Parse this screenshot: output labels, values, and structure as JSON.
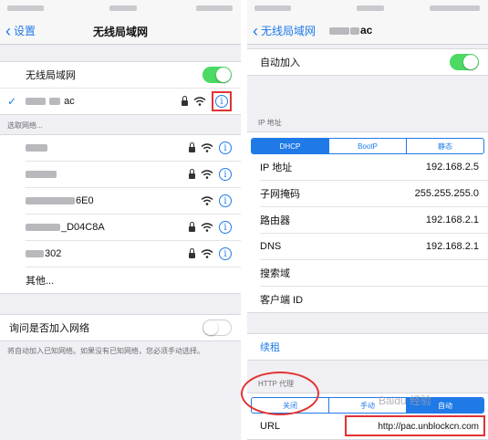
{
  "left": {
    "nav": {
      "back_label": "设置",
      "title": "无线局域网"
    },
    "wifi_toggle": {
      "label": "无线局域网",
      "on": true
    },
    "connected": {
      "name_suffix": "ac"
    },
    "section_label": "选取网络...",
    "networks": [
      {
        "name": "",
        "locked": true
      },
      {
        "name": "",
        "locked": true
      },
      {
        "name": "6E0",
        "locked": false
      },
      {
        "name": "_D04C8A",
        "locked": true
      },
      {
        "name": "302",
        "locked": true
      }
    ],
    "other_label": "其他...",
    "ask_join": {
      "label": "询问是否加入网络",
      "on": false,
      "note": "将自动加入已知网络。如果没有已知网络，您必须手动选择。"
    }
  },
  "right": {
    "nav": {
      "back_label": "无线局域网",
      "title_suffix": "ac"
    },
    "auto_join": {
      "label": "自动加入",
      "on": true
    },
    "ip_section_label": "IP 地址",
    "ip_tabs": [
      {
        "label": "DHCP",
        "selected": true
      },
      {
        "label": "BootP",
        "selected": false
      },
      {
        "label": "静态",
        "selected": false
      }
    ],
    "ip_rows": [
      {
        "label": "IP 地址",
        "value": "192.168.2.5"
      },
      {
        "label": "子网掩码",
        "value": "255.255.255.0"
      },
      {
        "label": "路由器",
        "value": "192.168.2.1"
      },
      {
        "label": "DNS",
        "value": "192.168.2.1"
      },
      {
        "label": "搜索域",
        "value": ""
      },
      {
        "label": "客户端 ID",
        "value": ""
      }
    ],
    "renew_label": "续租",
    "http_proxy_label": "HTTP 代理",
    "proxy_tabs": [
      {
        "label": "关闭",
        "selected": false
      },
      {
        "label": "手动",
        "selected": false
      },
      {
        "label": "自动",
        "selected": true
      }
    ],
    "url_row": {
      "label": "URL",
      "value": "http://pac.unblockcn.com"
    }
  },
  "watermark": "Baidu 经验",
  "colors": {
    "accent": "#1f7ae8",
    "toggle_on": "#4cd964",
    "annotation": "#e23232"
  }
}
